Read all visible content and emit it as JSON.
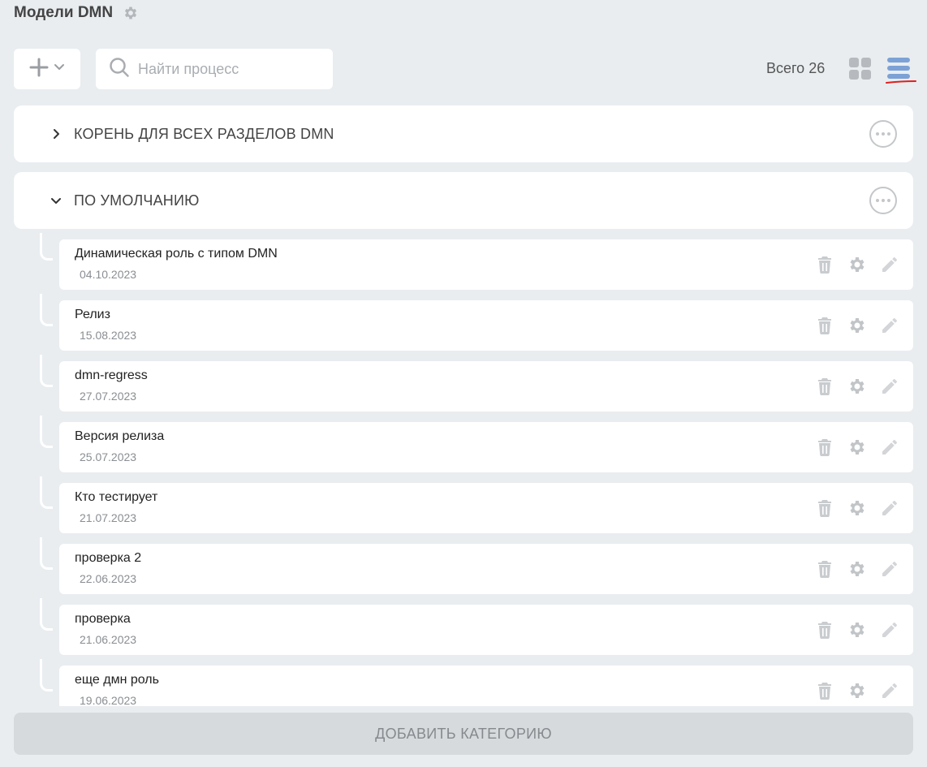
{
  "header": {
    "title": "Модели DMN",
    "title_icon": "gear-icon"
  },
  "toolbar": {
    "add_icon": "plus-icon",
    "search_placeholder": "Найти процесс",
    "search_value": "",
    "total_label": "Всего 26",
    "view_modes": [
      "grid-view-icon",
      "list-view-icon"
    ],
    "active_view": "list",
    "annotation_color": "#e0201e"
  },
  "categories": [
    {
      "label": "КОРЕНЬ ДЛЯ ВСЕХ РАЗДЕЛОВ DMN",
      "expanded": false
    },
    {
      "label": "ПО УМОЛЧАНИЮ",
      "expanded": true
    }
  ],
  "models": [
    {
      "name": "Динамическая роль с типом DMN",
      "date": "04.10.2023"
    },
    {
      "name": "Релиз",
      "date": "15.08.2023"
    },
    {
      "name": "dmn-regress",
      "date": "27.07.2023"
    },
    {
      "name": "Версия релиза",
      "date": "25.07.2023"
    },
    {
      "name": "Кто тестирует",
      "date": "21.07.2023"
    },
    {
      "name": "проверка 2",
      "date": "22.06.2023"
    },
    {
      "name": "проверка",
      "date": "21.06.2023"
    },
    {
      "name": "еще дмн роль",
      "date": "19.06.2023"
    }
  ],
  "row_action_icons": [
    "trash-icon",
    "gear-icon",
    "pencil-icon"
  ],
  "footer": {
    "add_category_label": "ДОБАВИТЬ КАТЕГОРИЮ"
  },
  "colors": {
    "background": "#e9edf0",
    "active_view": "#7ca1d6",
    "muted_icon": "#c4c7ca"
  }
}
